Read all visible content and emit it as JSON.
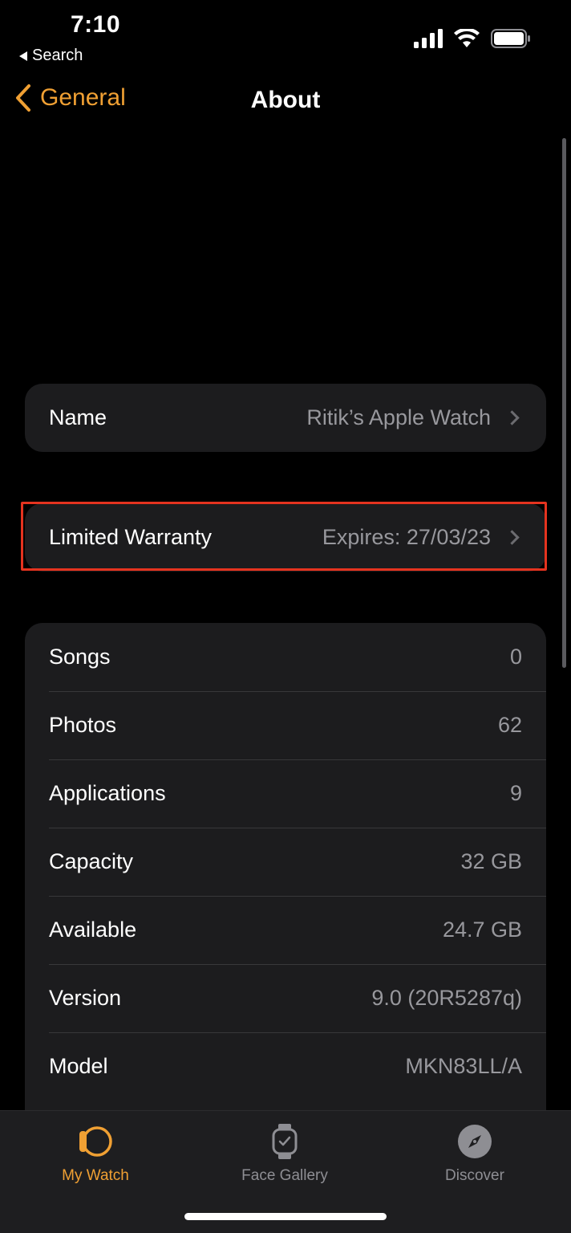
{
  "status_bar": {
    "time": "7:10",
    "back_label": "Search"
  },
  "nav": {
    "back_label": "General",
    "title": "About"
  },
  "name_group": {
    "label": "Name",
    "value": "Ritik’s Apple Watch"
  },
  "warranty_group": {
    "label": "Limited Warranty",
    "value": "Expires: 27/03/23"
  },
  "info_rows": [
    {
      "label": "Songs",
      "value": "0"
    },
    {
      "label": "Photos",
      "value": "62"
    },
    {
      "label": "Applications",
      "value": "9"
    },
    {
      "label": "Capacity",
      "value": "32 GB"
    },
    {
      "label": "Available",
      "value": "24.7 GB"
    },
    {
      "label": "Version",
      "value": "9.0 (20R5287q)"
    },
    {
      "label": "Model",
      "value": "MKN83LL/A"
    }
  ],
  "tabs": [
    {
      "label": "My Watch",
      "icon": "watch-icon",
      "active": true
    },
    {
      "label": "Face Gallery",
      "icon": "watch-face-icon",
      "active": false
    },
    {
      "label": "Discover",
      "icon": "compass-icon",
      "active": false
    }
  ],
  "colors": {
    "accent": "#f0a033",
    "highlight": "#e5331f",
    "background": "#000000",
    "cell": "#1c1c1e"
  }
}
